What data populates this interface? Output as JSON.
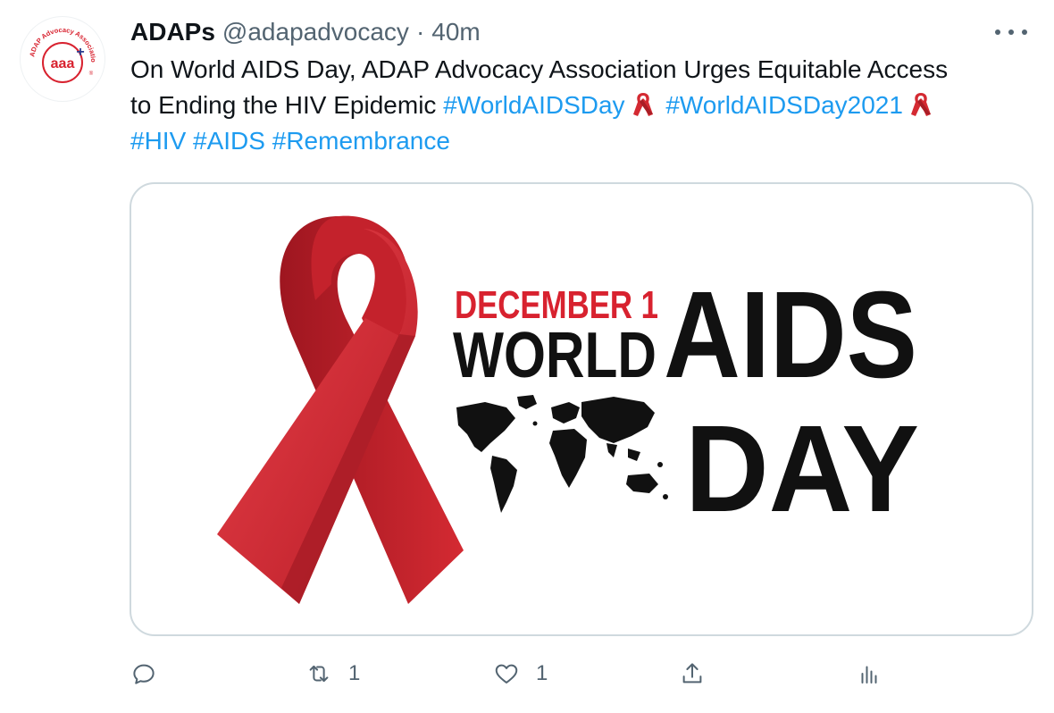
{
  "tweet": {
    "display_name": "ADAPs",
    "handle": "@adapadvocacy",
    "separator": "·",
    "time": "40m",
    "avatar": {
      "logo_text": "aaa",
      "logo_plus": "+",
      "ring_text": "ADAP Advocacy Association",
      "registered_mark": "®"
    },
    "text_line1": "On World AIDS Day, ADAP Advocacy Association Urges Equitable Access",
    "text_line2_prefix": "to Ending the HIV Epidemic ",
    "hashtags": {
      "worldaidsday": "#WorldAIDSDay",
      "worldaidsday2021": "#WorldAIDSDay2021",
      "hiv": "#HIV",
      "aids": "#AIDS",
      "remembrance": "#Remembrance"
    },
    "media": {
      "date": "DECEMBER 1",
      "word_world": "WORLD",
      "word_aids": "AIDS",
      "word_day": "DAY"
    },
    "actions": {
      "reply": {
        "icon": "reply-icon",
        "count": ""
      },
      "retweet": {
        "icon": "retweet-icon",
        "count": "1"
      },
      "like": {
        "icon": "heart-icon",
        "count": "1"
      },
      "share": {
        "icon": "share-icon",
        "count": ""
      },
      "analytics": {
        "icon": "analytics-icon",
        "count": ""
      }
    }
  },
  "colors": {
    "link": "#1d9bf0",
    "muted": "#536471",
    "ribbon": "#d42a32",
    "poster_red": "#d8222f",
    "poster_black": "#111111"
  }
}
